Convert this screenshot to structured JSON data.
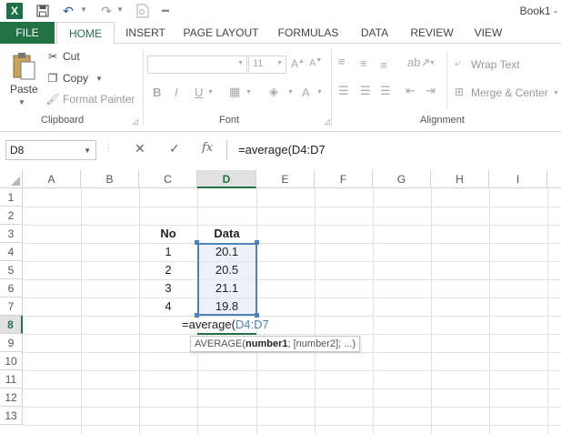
{
  "title": {
    "book": "Book1 -"
  },
  "quick_access": {
    "logo": "X"
  },
  "tabs": [
    "FILE",
    "HOME",
    "INSERT",
    "PAGE LAYOUT",
    "FORMULAS",
    "DATA",
    "REVIEW",
    "VIEW"
  ],
  "ribbon": {
    "clipboard": {
      "paste": "Paste",
      "cut": "Cut",
      "copy": "Copy",
      "format_painter": "Format Painter",
      "label": "Clipboard"
    },
    "font": {
      "size": "11",
      "bold": "B",
      "italic": "I",
      "underline": "U",
      "font_color": "A",
      "label": "Font"
    },
    "alignment": {
      "wrap_text": "Wrap Text",
      "merge_center": "Merge & Center",
      "label": "Alignment"
    }
  },
  "formula_bar": {
    "name_box": "D8",
    "cancel": "✕",
    "enter": "✓",
    "fx": "fx",
    "formula": "=average(D4:D7"
  },
  "columns": [
    "A",
    "B",
    "C",
    "D",
    "E",
    "F",
    "G",
    "H",
    "I"
  ],
  "rows": [
    "1",
    "2",
    "3",
    "4",
    "5",
    "6",
    "7",
    "8",
    "9",
    "10",
    "11",
    "12",
    "13"
  ],
  "cells": {
    "C3": "No",
    "D3": "Data",
    "C4": "1",
    "D4": "20.1",
    "C5": "2",
    "D5": "20.5",
    "C6": "3",
    "D6": "21.1",
    "C7": "4",
    "D7": "19.8"
  },
  "editing": {
    "prefix": "=average(",
    "ref": "D4:D7"
  },
  "tooltip": {
    "fn": "AVERAGE(",
    "arg1": "number1",
    "rest": "; [number2]; ...)"
  },
  "colors": {
    "excel_green": "#217346",
    "ref_blue": "#4f81bd"
  }
}
